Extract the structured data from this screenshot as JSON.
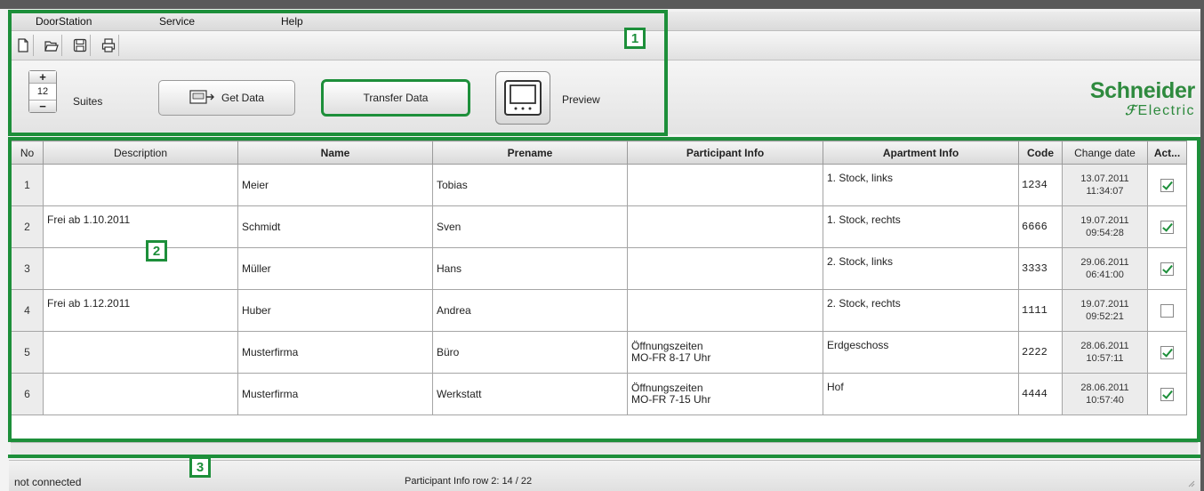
{
  "menu": {
    "items": [
      "DoorStation",
      "Service",
      "Help"
    ]
  },
  "toolbar": {
    "buttons": [
      "new-file-icon",
      "open-folder-icon",
      "save-icon",
      "print-icon"
    ]
  },
  "ribbon": {
    "stepper_value": "12",
    "stepper_plus": "+",
    "stepper_minus": "−",
    "suites_label": "Suites",
    "get_data_label": "Get Data",
    "transfer_data_label": "Transfer Data",
    "preview_label": "Preview"
  },
  "logo": {
    "main": "Schneider",
    "sub": "Electric"
  },
  "callouts": [
    "1",
    "2",
    "3"
  ],
  "grid": {
    "columns": [
      "No",
      "Description",
      "Name",
      "Prename",
      "Participant Info",
      "Apartment Info",
      "Code",
      "Change date",
      "Act..."
    ],
    "rows": [
      {
        "no": "1",
        "description": "",
        "name": "Meier",
        "prename": "Tobias",
        "pinfo1": "",
        "pinfo2": "",
        "apartment": "1. Stock, links",
        "code": "1234",
        "date": "13.07.2011",
        "time": "11:34:07",
        "active": true
      },
      {
        "no": "2",
        "description": "Frei ab 1.10.2011",
        "name": "Schmidt",
        "prename": "Sven",
        "pinfo1": "",
        "pinfo2": "",
        "apartment": "1. Stock, rechts",
        "code": "6666",
        "date": "19.07.2011",
        "time": "09:54:28",
        "active": true
      },
      {
        "no": "3",
        "description": "",
        "name": "Müller",
        "prename": "Hans",
        "pinfo1": "",
        "pinfo2": "",
        "apartment": "2. Stock, links",
        "code": "3333",
        "date": "29.06.2011",
        "time": "06:41:00",
        "active": true
      },
      {
        "no": "4",
        "description": "Frei ab 1.12.2011",
        "name": "Huber",
        "prename": "Andrea",
        "pinfo1": "",
        "pinfo2": "",
        "apartment": "2. Stock, rechts",
        "code": "1111",
        "date": "19.07.2011",
        "time": "09:52:21",
        "active": false
      },
      {
        "no": "5",
        "description": "",
        "name": "Musterfirma",
        "prename": "Büro",
        "pinfo1": "Öffnungszeiten",
        "pinfo2": "MO-FR 8-17 Uhr",
        "apartment": "Erdgeschoss",
        "code": "2222",
        "date": "28.06.2011",
        "time": "10:57:11",
        "active": true
      },
      {
        "no": "6",
        "description": "",
        "name": "Musterfirma",
        "prename": "Werkstatt",
        "pinfo1": "Öffnungszeiten",
        "pinfo2": "MO-FR 7-15 Uhr",
        "apartment": "Hof",
        "code": "4444",
        "date": "28.06.2011",
        "time": "10:57:40",
        "active": true
      }
    ]
  },
  "status": {
    "connection": "not connected",
    "info": "Participant Info row 2: 14 / 22"
  },
  "colors": {
    "highlight_green": "#1d8f3a",
    "brand_green": "#2e8a3e"
  }
}
